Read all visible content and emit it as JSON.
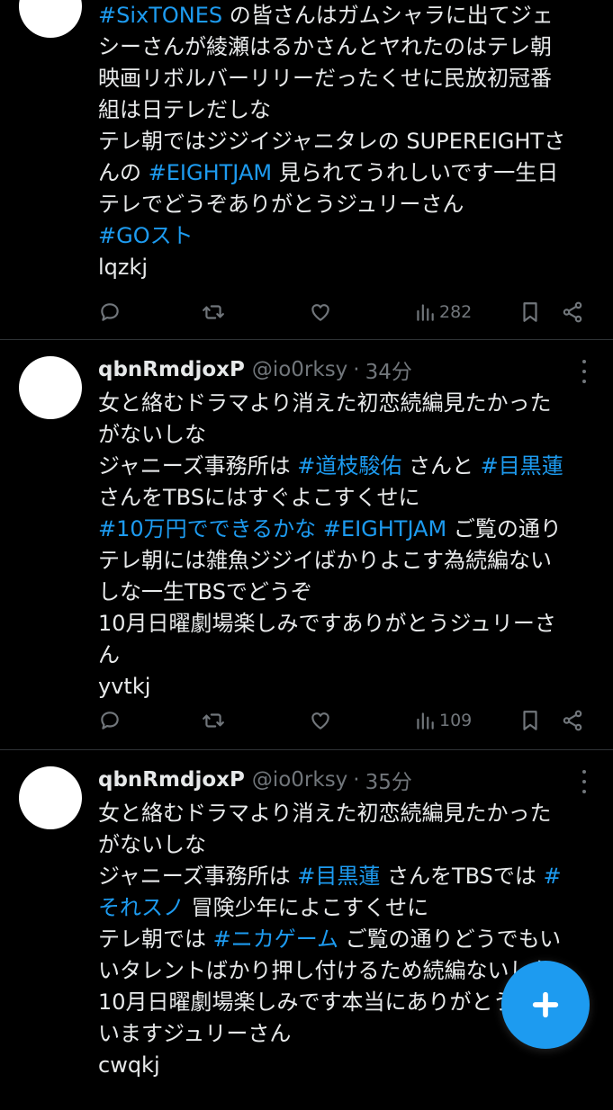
{
  "tweets": [
    {
      "author_name": "",
      "author_handle": "",
      "time": "",
      "lines": [
        [
          {
            "t": "#SixTONES",
            "tag": true
          },
          {
            "t": " の皆さんはガムシャラに出てジェ"
          }
        ],
        [
          {
            "t": "シーさんが綾瀬はるかさんとヤれたのはテレ朝"
          }
        ],
        [
          {
            "t": "映画リボルバーリリーだったくせに民放初冠番"
          }
        ],
        [
          {
            "t": "組は日テレだしな"
          }
        ],
        [
          {
            "t": "テレ朝ではジジイジャニタレの SUPEREIGHTさ"
          }
        ],
        [
          {
            "t": "んの "
          },
          {
            "t": "#EIGHTJAM",
            "tag": true
          },
          {
            "t": " 見られてうれしいです一生日"
          }
        ],
        [
          {
            "t": "テレでどうぞありがとうジュリーさん"
          }
        ],
        [
          {
            "t": "#GOスト",
            "tag": true
          }
        ],
        [
          {
            "t": "lqzkj"
          }
        ]
      ],
      "views": "282"
    },
    {
      "author_name": "qbnRmdjoxP",
      "author_handle": "@io0rksy",
      "time": "34分",
      "lines": [
        [
          {
            "t": "女と絡むドラマより消えた初恋続編見たかった"
          }
        ],
        [
          {
            "t": "がないしな"
          }
        ],
        [
          {
            "t": "ジャニーズ事務所は "
          },
          {
            "t": "#道枝駿佑",
            "tag": true
          },
          {
            "t": " さんと "
          },
          {
            "t": "#目黒蓮",
            "tag": true
          }
        ],
        [
          {
            "t": "さんをTBSにはすぐよこすくせに"
          }
        ],
        [
          {
            "t": "#10万円でできるかな",
            "tag": true
          },
          {
            "t": " "
          },
          {
            "t": "#EIGHTJAM",
            "tag": true
          },
          {
            "t": " ご覧の通り"
          }
        ],
        [
          {
            "t": "テレ朝には雑魚ジジイばかりよこす為続編ない"
          }
        ],
        [
          {
            "t": "しな一生TBSでどうぞ"
          }
        ],
        [
          {
            "t": "10月日曜劇場楽しみですありがとうジュリーさ"
          }
        ],
        [
          {
            "t": "ん"
          }
        ],
        [
          {
            "t": "yvtkj"
          }
        ]
      ],
      "views": "109"
    },
    {
      "author_name": "qbnRmdjoxP",
      "author_handle": "@io0rksy",
      "time": "35分",
      "lines": [
        [
          {
            "t": "女と絡むドラマより消えた初恋続編見たかった"
          }
        ],
        [
          {
            "t": "がないしな"
          }
        ],
        [
          {
            "t": "ジャニーズ事務所は "
          },
          {
            "t": "#目黒蓮",
            "tag": true
          },
          {
            "t": " さんをTBSでは "
          },
          {
            "t": "#",
            "tag": true
          }
        ],
        [
          {
            "t": "それスノ",
            "tag": true
          },
          {
            "t": " 冒険少年によこすくせに"
          }
        ],
        [
          {
            "t": "テレ朝では "
          },
          {
            "t": "#ニカゲーム",
            "tag": true
          },
          {
            "t": " ご覧の通りどうでもい"
          }
        ],
        [
          {
            "t": "いタレントばかり押し付けるため続編ないしな"
          }
        ],
        [
          {
            "t": "10月日曜劇場楽しみです本当にありがとうござ"
          }
        ],
        [
          {
            "t": "いますジュリーさん"
          }
        ],
        [
          {
            "t": "cwqkj"
          }
        ]
      ]
    }
  ],
  "icons": {
    "reply": "reply-icon",
    "retweet": "retweet-icon",
    "like": "heart-icon",
    "views": "views-icon",
    "bookmark": "bookmark-icon",
    "share": "share-icon",
    "compose": "plus-icon"
  },
  "colors": {
    "background": "#000000",
    "text": "#e7e9ea",
    "muted": "#71767b",
    "accent": "#1d9bf0",
    "divider": "#2f3336"
  }
}
